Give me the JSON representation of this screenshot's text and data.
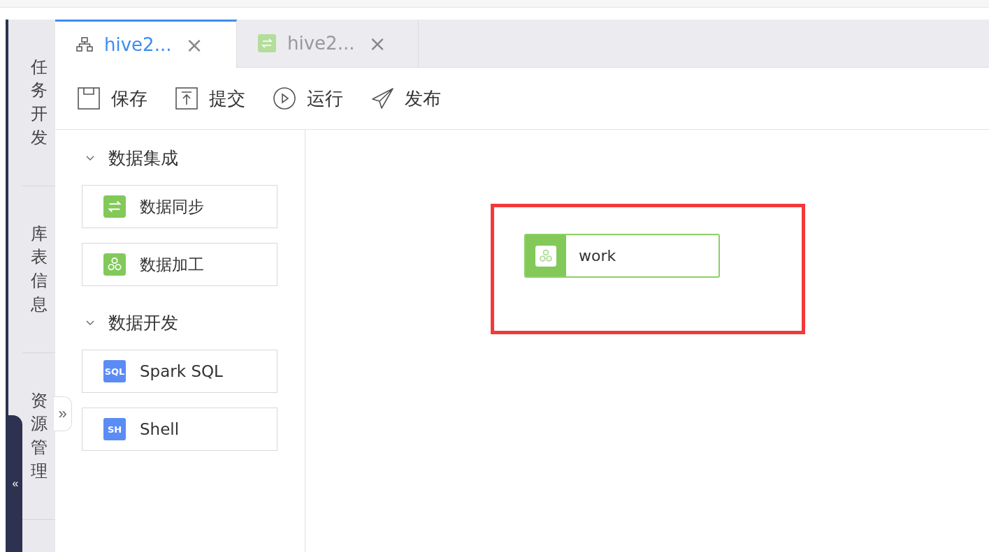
{
  "side_nav": [
    {
      "label": "任务开发"
    },
    {
      "label": "库表信息"
    },
    {
      "label": "资源管理"
    }
  ],
  "collapse_button": {
    "label": "«"
  },
  "expand_button": {
    "label": "»"
  },
  "tabs": [
    {
      "label": "hive2...",
      "kind": "flow",
      "selected": true,
      "close": "×"
    },
    {
      "label": "hive2...",
      "kind": "sync",
      "selected": false,
      "close": "×"
    }
  ],
  "toolbar": [
    {
      "label": "保存",
      "kind": "save"
    },
    {
      "label": "提交",
      "kind": "submit"
    },
    {
      "label": "运行",
      "kind": "run"
    },
    {
      "label": "发布",
      "kind": "publish"
    }
  ],
  "palette": [
    {
      "title": "数据集成",
      "expanded": true,
      "items": [
        {
          "label": "数据同步",
          "kind": "sync"
        },
        {
          "label": "数据加工",
          "kind": "process"
        }
      ]
    },
    {
      "title": "数据开发",
      "expanded": true,
      "items": [
        {
          "label": "Spark SQL",
          "kind": "badge",
          "badge": "SQL"
        },
        {
          "label": "Shell",
          "kind": "badge",
          "badge": "SH"
        }
      ]
    }
  ],
  "canvas": {
    "nodes": [
      {
        "label": "work",
        "kind": "process"
      }
    ],
    "highlight": true
  }
}
